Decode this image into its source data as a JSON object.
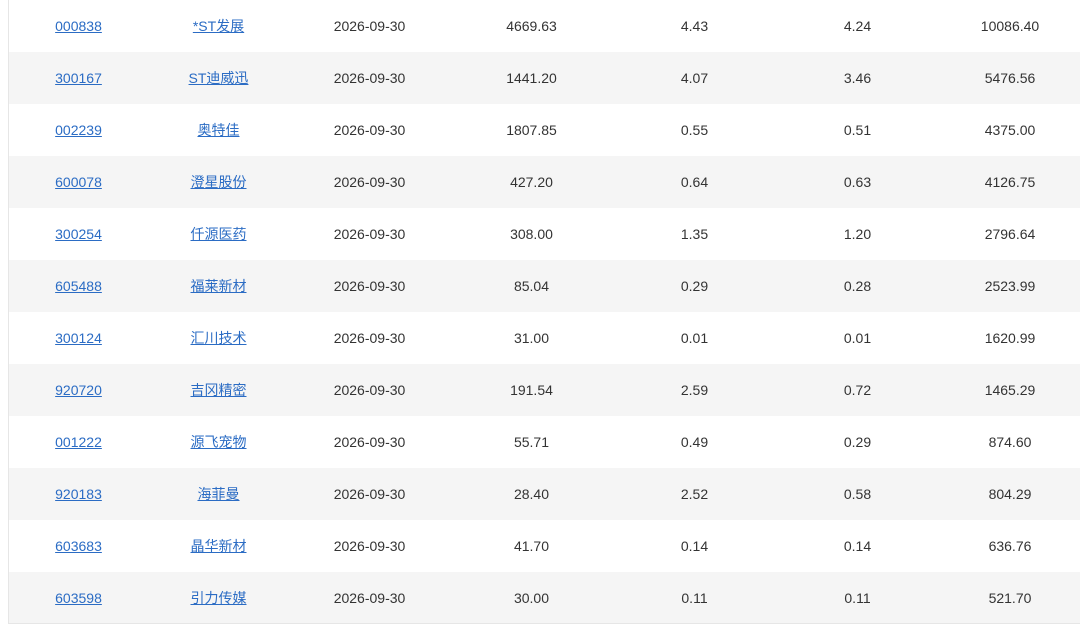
{
  "table": {
    "rows": [
      {
        "code": "000838",
        "name": "*ST发展",
        "date": "2026-09-30",
        "v1": "4669.63",
        "v2": "4.43",
        "v3": "4.24",
        "v4": "10086.40"
      },
      {
        "code": "300167",
        "name": "ST迪威迅",
        "date": "2026-09-30",
        "v1": "1441.20",
        "v2": "4.07",
        "v3": "3.46",
        "v4": "5476.56"
      },
      {
        "code": "002239",
        "name": "奥特佳",
        "date": "2026-09-30",
        "v1": "1807.85",
        "v2": "0.55",
        "v3": "0.51",
        "v4": "4375.00"
      },
      {
        "code": "600078",
        "name": "澄星股份",
        "date": "2026-09-30",
        "v1": "427.20",
        "v2": "0.64",
        "v3": "0.63",
        "v4": "4126.75"
      },
      {
        "code": "300254",
        "name": "仟源医药",
        "date": "2026-09-30",
        "v1": "308.00",
        "v2": "1.35",
        "v3": "1.20",
        "v4": "2796.64"
      },
      {
        "code": "605488",
        "name": "福莱新材",
        "date": "2026-09-30",
        "v1": "85.04",
        "v2": "0.29",
        "v3": "0.28",
        "v4": "2523.99"
      },
      {
        "code": "300124",
        "name": "汇川技术",
        "date": "2026-09-30",
        "v1": "31.00",
        "v2": "0.01",
        "v3": "0.01",
        "v4": "1620.99"
      },
      {
        "code": "920720",
        "name": "吉冈精密",
        "date": "2026-09-30",
        "v1": "191.54",
        "v2": "2.59",
        "v3": "0.72",
        "v4": "1465.29"
      },
      {
        "code": "001222",
        "name": "源飞宠物",
        "date": "2026-09-30",
        "v1": "55.71",
        "v2": "0.49",
        "v3": "0.29",
        "v4": "874.60"
      },
      {
        "code": "920183",
        "name": "海菲曼",
        "date": "2026-09-30",
        "v1": "28.40",
        "v2": "2.52",
        "v3": "0.58",
        "v4": "804.29"
      },
      {
        "code": "603683",
        "name": "晶华新材",
        "date": "2026-09-30",
        "v1": "41.70",
        "v2": "0.14",
        "v3": "0.14",
        "v4": "636.76"
      },
      {
        "code": "603598",
        "name": "引力传媒",
        "date": "2026-09-30",
        "v1": "30.00",
        "v2": "0.11",
        "v3": "0.11",
        "v4": "521.70"
      }
    ]
  },
  "colors": {
    "link": "#2b6cc4",
    "text": "#333333",
    "stripe": "#f5f5f5",
    "border": "#e6e6e6"
  }
}
